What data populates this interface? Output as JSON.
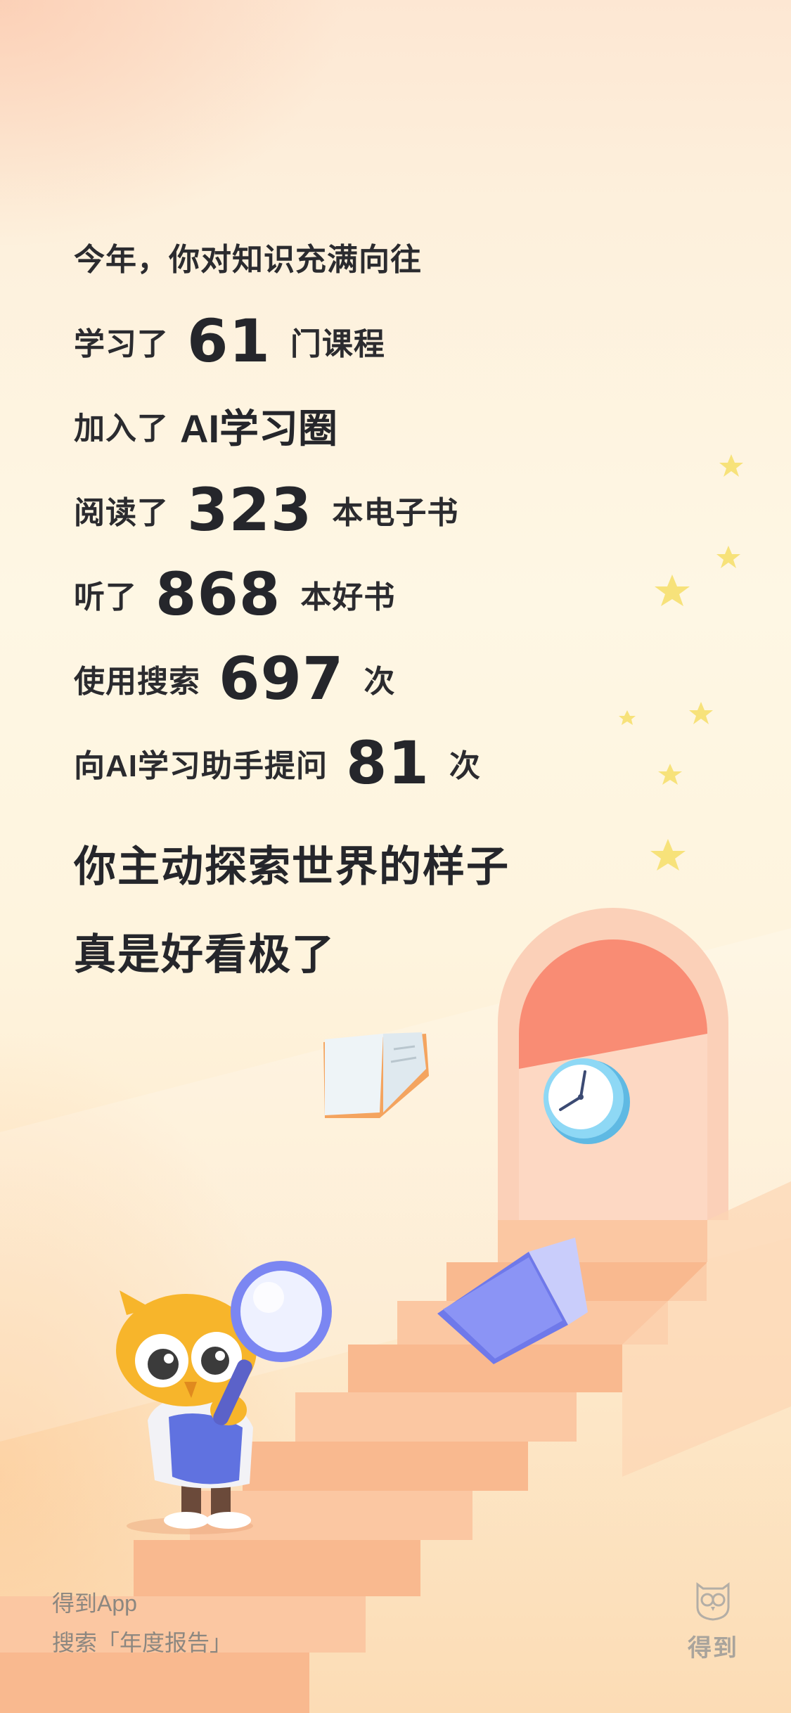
{
  "stats": {
    "intro": "今年，你对知识充满向往",
    "courses": {
      "prefix": "学习了",
      "value": "61",
      "suffix": "门课程"
    },
    "circle": {
      "prefix": "加入了",
      "highlight": "AI学习圈"
    },
    "ebooks": {
      "prefix": "阅读了",
      "value": "323",
      "suffix": "本电子书"
    },
    "listened": {
      "prefix": "听了",
      "value": "868",
      "suffix": "本好书"
    },
    "search": {
      "prefix": "使用搜索",
      "value": "697",
      "suffix": "次"
    },
    "ai_questions": {
      "prefix": "向AI学习助手提问",
      "value": "81",
      "suffix": "次"
    }
  },
  "closing": {
    "line1": "你主动探索世界的样子",
    "line2": "真是好看极了"
  },
  "footer": {
    "app_name": "得到App",
    "search_hint": "搜索「年度报告」",
    "brand": "得到"
  },
  "colors": {
    "text": "#2b2b2f",
    "door": "#f98c74",
    "stairs": "#f9b98f",
    "star": "#f7e27a",
    "book": "#7b86f2",
    "clock": "#6cc7ec"
  },
  "icons": [
    "star-icon",
    "book-icon",
    "clock-icon",
    "magnifier-icon",
    "owl-mascot",
    "owl-logo-icon"
  ]
}
